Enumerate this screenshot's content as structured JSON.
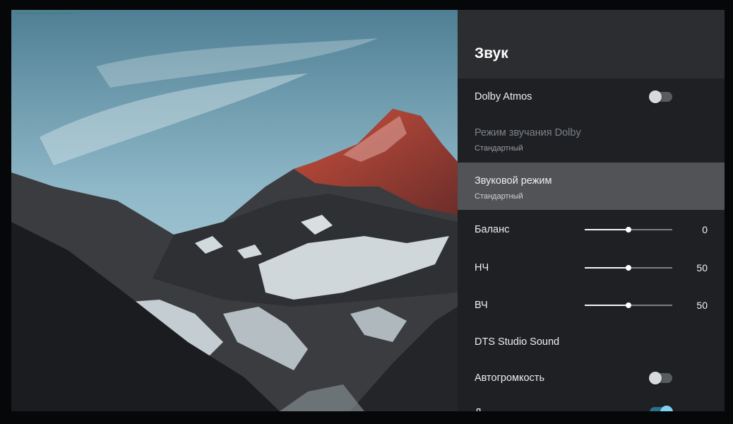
{
  "panel": {
    "title": "Звук",
    "items": {
      "dolby_atmos": {
        "label": "Dolby Atmos",
        "toggle_on": false
      },
      "dolby_mode": {
        "label": "Режим звучания Dolby",
        "value": "Стандартный",
        "enabled": false
      },
      "sound_mode": {
        "label": "Звуковой режим",
        "value": "Стандартный",
        "focused": true
      },
      "balance": {
        "label": "Баланс",
        "value": "0",
        "slider_fraction": 0.5
      },
      "bass": {
        "label": "НЧ",
        "value": "50",
        "slider_fraction": 0.5
      },
      "treble": {
        "label": "ВЧ",
        "value": "50",
        "slider_fraction": 0.5
      },
      "dts": {
        "label": "DTS Studio Sound"
      },
      "auto_volume": {
        "label": "Автогромкость",
        "toggle_on": false
      },
      "next_item": {
        "label": "Д",
        "toggle_on": true
      }
    }
  },
  "colors": {
    "panel_bg": "#1e2023",
    "header_bg": "#2b2d30",
    "focus_bg": "#515356",
    "toggle_on_accent": "#7fd1f2"
  },
  "background_image": {
    "subject": "snowy mountain peak at sunset"
  }
}
